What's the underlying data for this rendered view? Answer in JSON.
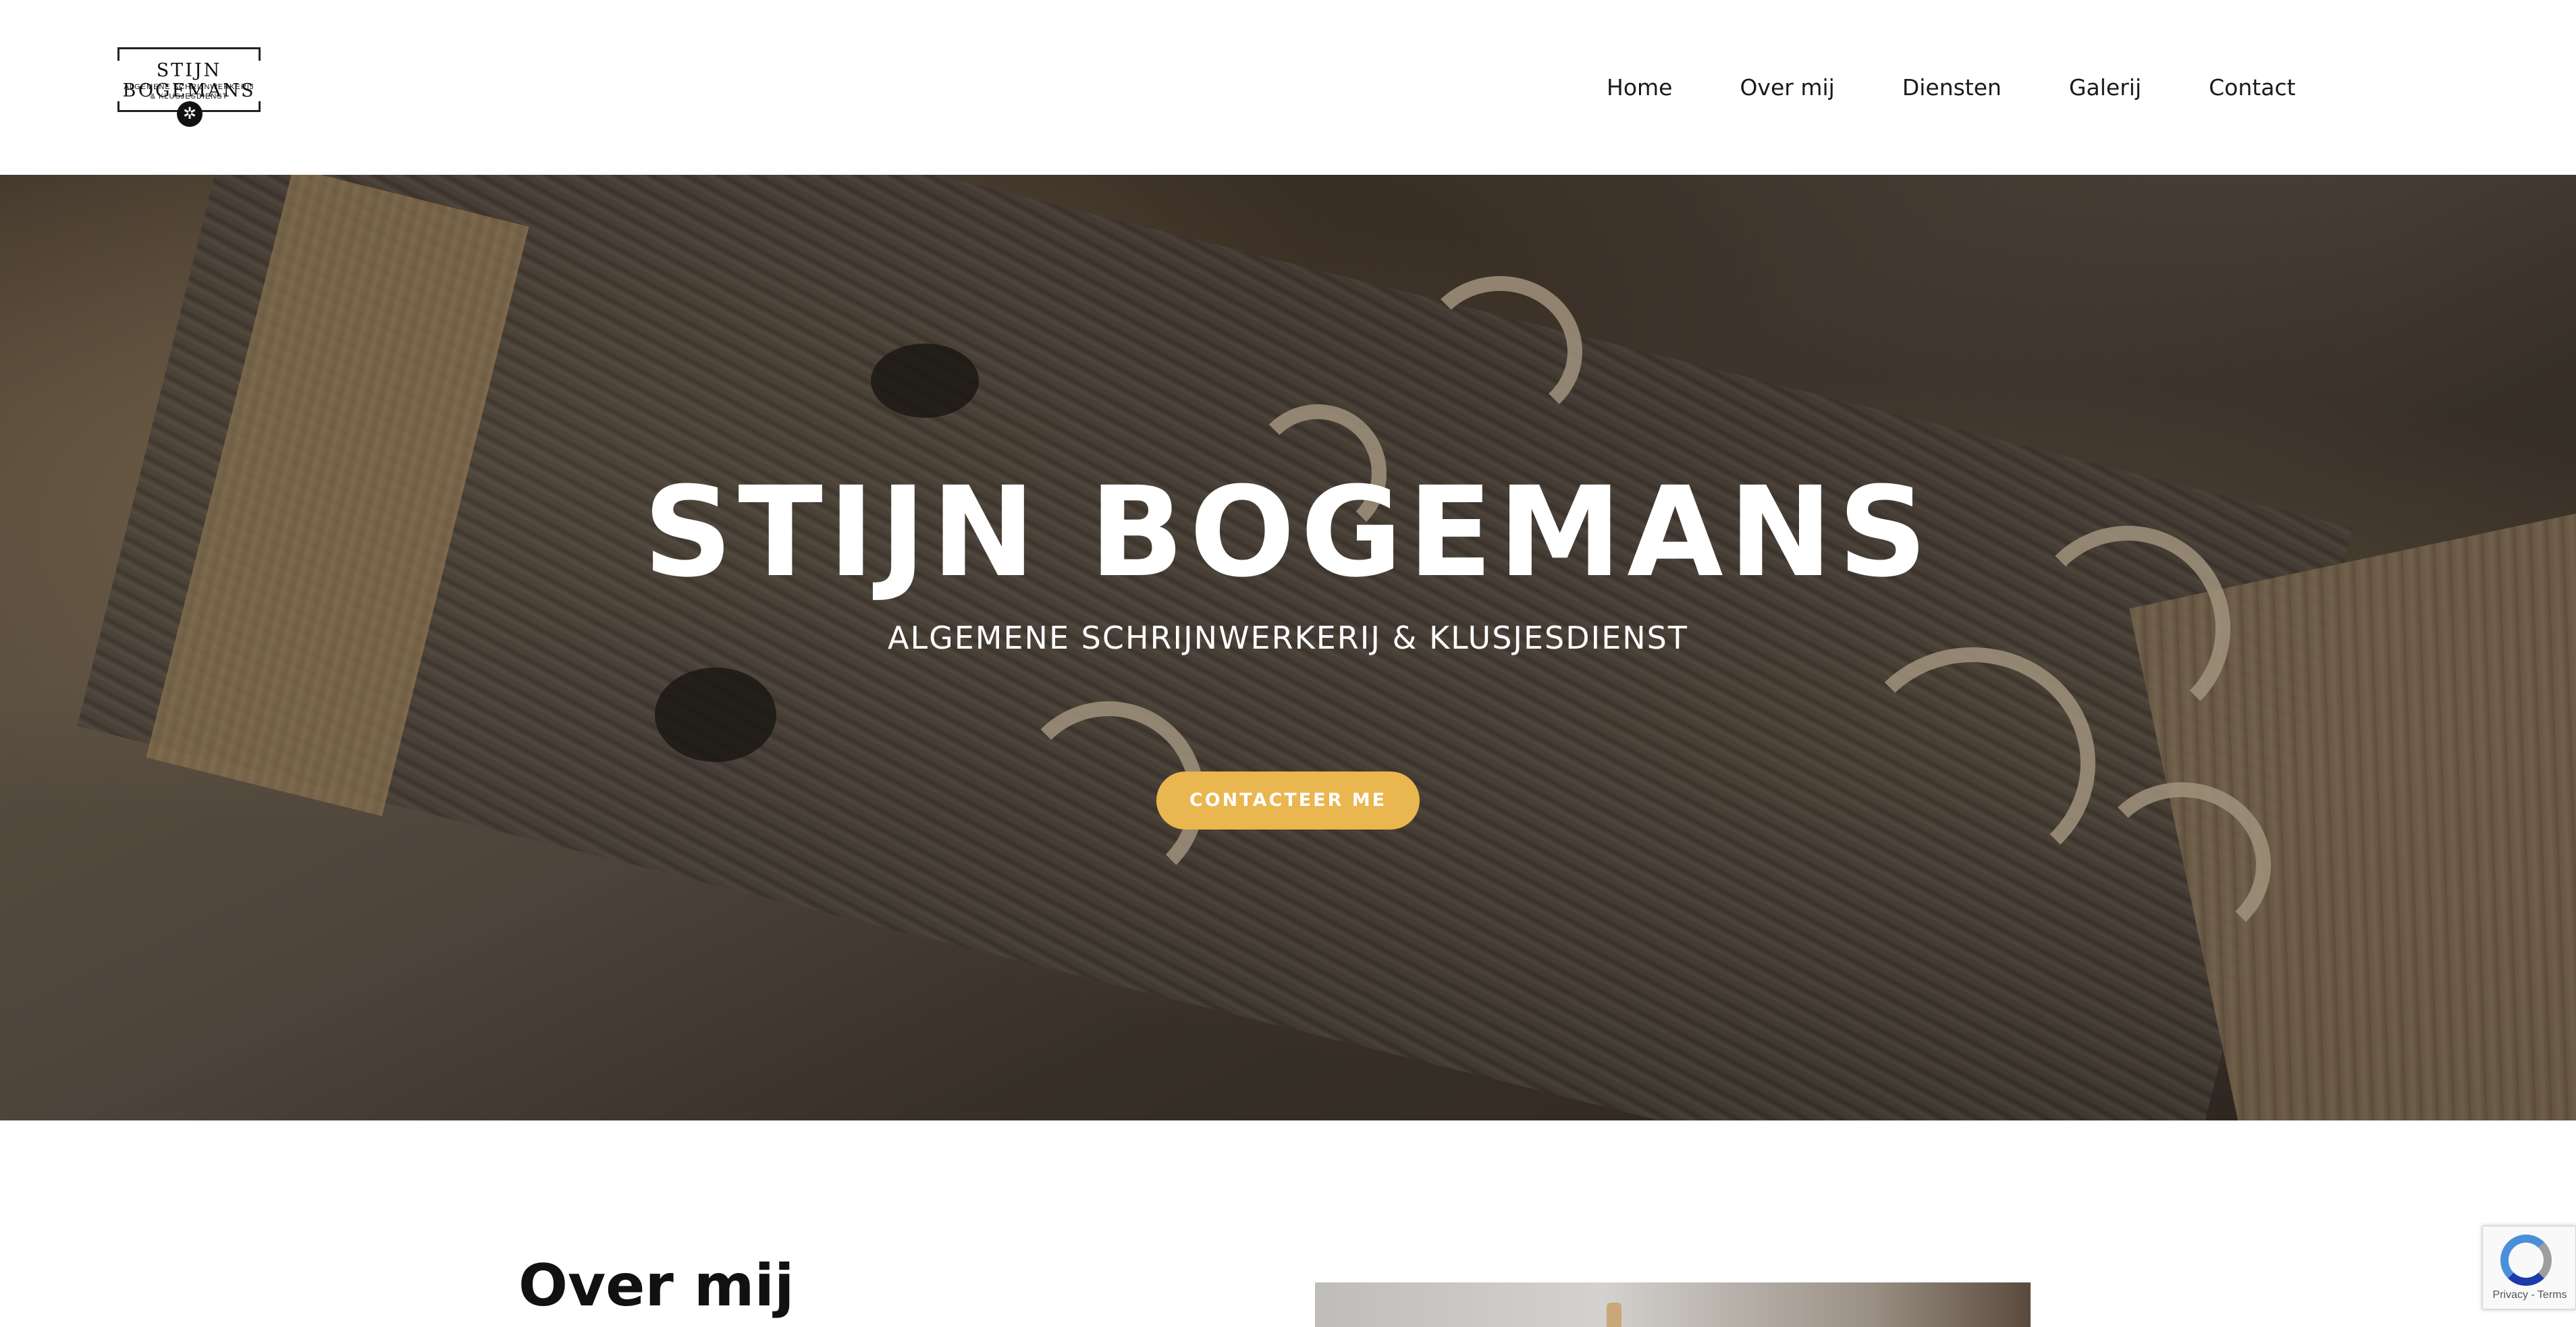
{
  "header": {
    "logo": {
      "title": "STIJN BOGEMANS",
      "subtitle_line1": "ALGEMENE SCHRIJNWERKERIJ",
      "subtitle_line2": "& KLUSJESDIENST",
      "emblem_icon": "saw-blade-icon"
    },
    "nav": [
      {
        "label": "Home"
      },
      {
        "label": "Over mij"
      },
      {
        "label": "Diensten"
      },
      {
        "label": "Galerij"
      },
      {
        "label": "Contact"
      }
    ]
  },
  "hero": {
    "title": "STIJN BOGEMANS",
    "subtitle": "ALGEMENE SCHRIJNWERKERIJ & KLUSJESDIENST",
    "cta_label": "CONTACTEER ME",
    "cta_color": "#e9b64f"
  },
  "about": {
    "title": "Over mij"
  },
  "recaptcha": {
    "icon": "recaptcha-icon",
    "text": "Privacy - Terms"
  }
}
